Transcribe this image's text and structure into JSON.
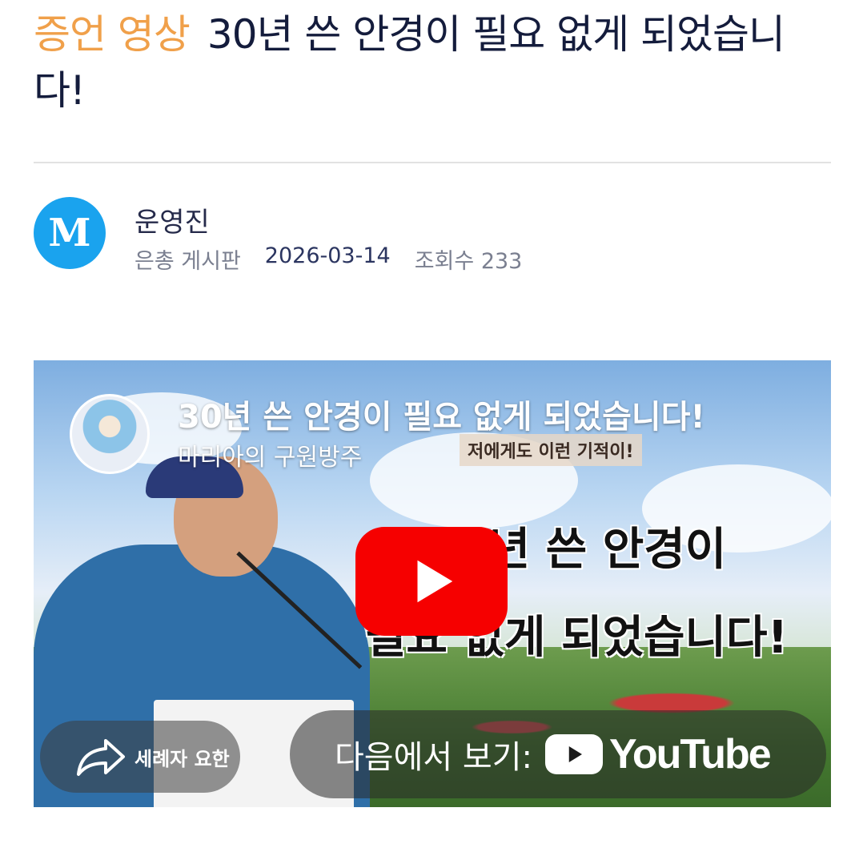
{
  "post": {
    "category": "증언 영상",
    "title": "30년 쓴 안경이 필요 없게 되었습니다!"
  },
  "author": {
    "avatar_letter": "M",
    "name": "운영진",
    "board": "은총 게시판",
    "date": "2026-03-14",
    "views": "조회수 233"
  },
  "video": {
    "title": "30년 쓴 안경이 필요 없게 되었습니다!",
    "channel": "마리아의 구원방주",
    "sticker_text": "저에게도 이런 기적이!",
    "thumbnail_text_line1": "30년 쓴 안경이",
    "thumbnail_text_line2": "필요 없게 되었습니다!",
    "share_label": "세례자 요한",
    "watch_on_label": "다음에서 보기:",
    "platform": "YouTube",
    "play_color": "#f60000",
    "icons": [
      "play-icon",
      "share-icon",
      "youtube-icon"
    ]
  },
  "colors": {
    "category": "#f0a04a",
    "title": "#141c3c",
    "avatar": "#1aa3ee"
  }
}
